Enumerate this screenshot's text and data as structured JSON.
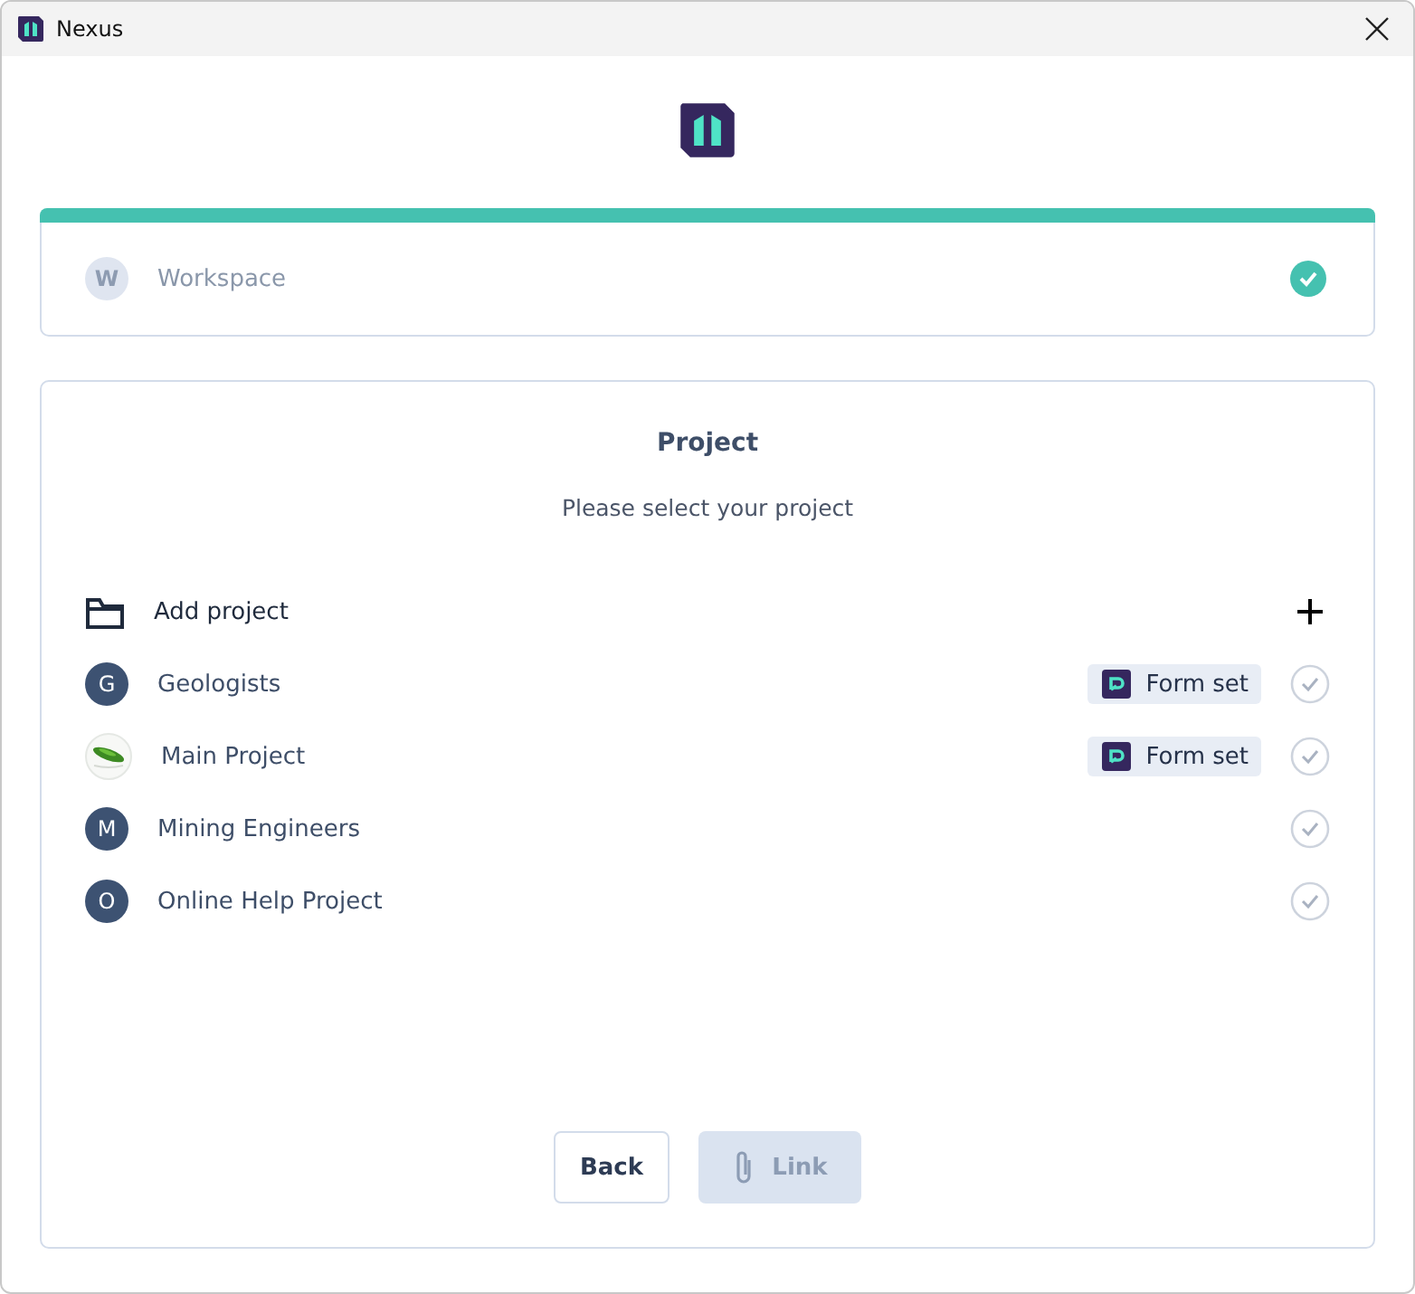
{
  "window": {
    "title": "Nexus"
  },
  "workspace": {
    "avatar": "W",
    "label": "Workspace",
    "done": true,
    "level": 1
  },
  "project": {
    "title": "Project",
    "subtitle": "Please select your project",
    "add": {
      "label": "Add project"
    },
    "items": [
      {
        "kind": "initial",
        "avatar": "G",
        "name": "Geologists",
        "badge": "Form set",
        "selected": false
      },
      {
        "kind": "picture",
        "name": "Main Project",
        "badge": "Form set",
        "selected": false
      },
      {
        "kind": "initial",
        "avatar": "M",
        "name": "Mining Engineers",
        "selected": false
      },
      {
        "kind": "initial",
        "avatar": "O",
        "name": "Online Help Project",
        "selected": false
      }
    ]
  },
  "buttons": [
    {
      "kind": "secondary",
      "label": "Back",
      "disabled": false
    },
    {
      "kind": "primary",
      "label": "Link",
      "disabled": true
    }
  ]
}
